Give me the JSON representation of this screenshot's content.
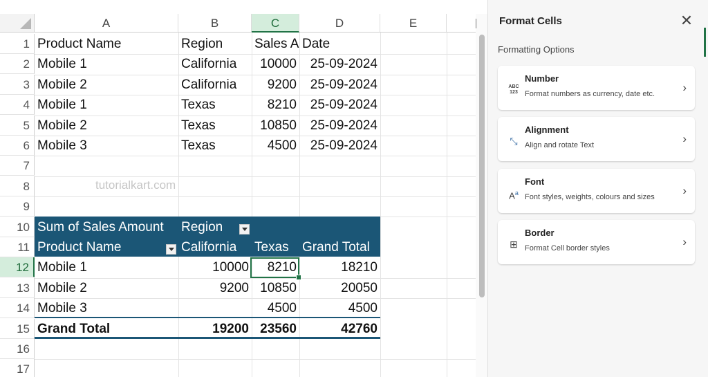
{
  "sheet": {
    "columns": [
      "A",
      "B",
      "C",
      "D",
      "E"
    ],
    "rows": [
      "1",
      "2",
      "3",
      "4",
      "5",
      "6",
      "7",
      "8",
      "9",
      "10",
      "11",
      "12",
      "13",
      "14",
      "15",
      "16",
      "17"
    ],
    "data": [
      [
        "Product Name",
        "Region",
        "Sales A",
        "Date"
      ],
      [
        "Mobile 1",
        "California",
        "10000",
        "25-09-2024"
      ],
      [
        "Mobile 2",
        "California",
        "9200",
        "25-09-2024"
      ],
      [
        "Mobile 1",
        "Texas",
        "8210",
        "25-09-2024"
      ],
      [
        "Mobile 2",
        "Texas",
        "10850",
        "25-09-2024"
      ],
      [
        "Mobile 3",
        "Texas",
        "4500",
        "25-09-2024"
      ]
    ],
    "watermark": "tutorialkart.com",
    "pivot": {
      "header1": [
        "Sum of Sales Amount",
        "Region"
      ],
      "header2": [
        "Product Name",
        "California",
        "Texas",
        "Grand Total"
      ],
      "rows": [
        [
          "Mobile 1",
          "10000",
          "8210",
          "18210"
        ],
        [
          "Mobile 2",
          "9200",
          "10850",
          "20050"
        ],
        [
          "Mobile 3",
          "",
          "4500",
          "4500"
        ]
      ],
      "total": [
        "Grand Total",
        "19200",
        "23560",
        "42760"
      ]
    },
    "selected_column": "C",
    "selected_row": "12",
    "pivot_color": "#1b5676",
    "accent_color": "#217346"
  },
  "panel": {
    "title": "Format Cells",
    "section": "Formatting Options",
    "cards": [
      {
        "title": "Number",
        "desc": "Format numbers as currency, date etc.",
        "icon": "number-format-icon",
        "glyph": "ABC\n123"
      },
      {
        "title": "Alignment",
        "desc": "Align and rotate Text",
        "icon": "alignment-icon",
        "glyph": "⤡"
      },
      {
        "title": "Font",
        "desc": "Font styles, weights, colours and sizes",
        "icon": "font-icon",
        "glyph": "Aᵃ"
      },
      {
        "title": "Border",
        "desc": "Format Cell border styles",
        "icon": "border-icon",
        "glyph": "⊞"
      }
    ],
    "highlight_color": "#e53935"
  }
}
